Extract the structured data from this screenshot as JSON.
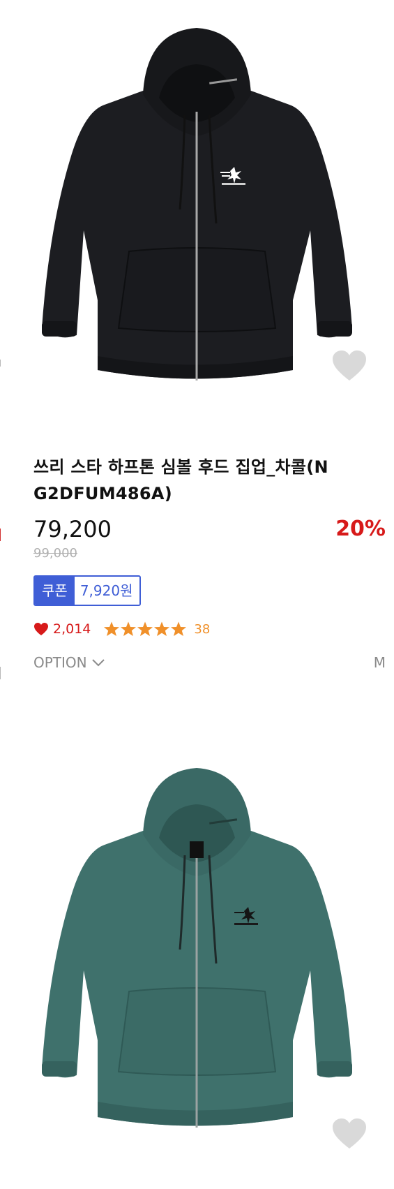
{
  "products": [
    {
      "title": "쓰리 스타 하프톤 심볼 후드 집업_차콜(NG2DFUM486A)",
      "title_line1": "쓰리 스타 하프톤 심볼 후드 집업_차콜(N",
      "title_line2": "G2DFUM486A)",
      "sale_price": "79,200",
      "original_price": "99,000",
      "discount": "20%",
      "coupon_label": "쿠폰",
      "coupon_amount": "7,920원",
      "likes": "2,014",
      "rating_stars": 5,
      "review_count": "38",
      "option_label": "OPTION",
      "option_value": "M",
      "image_icon": "charcoal-zip-hoodie-image",
      "colors": {
        "garment": "#1c1d21"
      }
    },
    {
      "image_icon": "teal-zip-hoodie-image",
      "colors": {
        "garment": "#3f716c"
      }
    }
  ],
  "colors": {
    "price_red": "#d71a1a",
    "coupon_blue": "#3f5ed6",
    "star_orange": "#f0902a",
    "muted_gray": "#8a8a8a",
    "wish_heart_gray": "#d9d9d9"
  },
  "icons": {
    "wish": "heart-outline-icon",
    "like": "heart-icon",
    "rating": "star-icon",
    "option": "chevron-down-icon"
  }
}
